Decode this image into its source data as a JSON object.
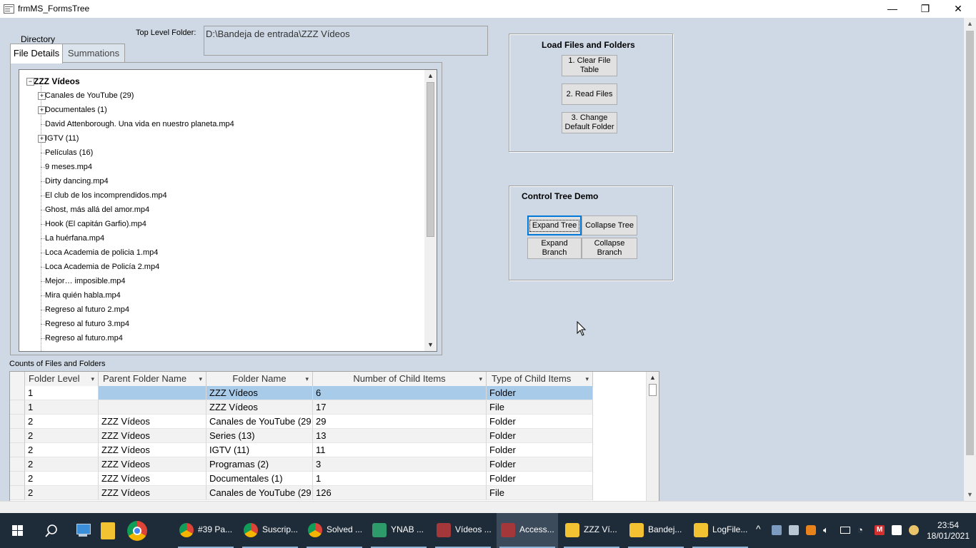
{
  "window": {
    "title": "frmMS_FormsTree",
    "controls": {
      "minimize": "—",
      "restore": "❐",
      "close": "✕"
    }
  },
  "form": {
    "directory_label": "Directory",
    "top_folder_label": "Top Level Folder:",
    "top_folder_value": "D:\\Bandeja de entrada\\ZZZ Vídeos",
    "tabs": [
      {
        "label": "File Details",
        "active": true
      },
      {
        "label": "Summations",
        "active": false
      }
    ],
    "tree": {
      "root": "ZZZ Vídeos",
      "nodes": [
        {
          "label": "Canales de YouTube (29)",
          "expandable": true
        },
        {
          "label": "Documentales (1)",
          "expandable": true
        },
        {
          "label": "David Attenborough. Una vida en nuestro planeta.mp4",
          "expandable": false
        },
        {
          "label": "IGTV (11)",
          "expandable": true
        },
        {
          "label": "Películas (16)",
          "expandable": false
        },
        {
          "label": "9 meses.mp4",
          "expandable": false
        },
        {
          "label": "Dirty dancing.mp4",
          "expandable": false
        },
        {
          "label": "El club de los incomprendidos.mp4",
          "expandable": false
        },
        {
          "label": "Ghost, más allá del amor.mp4",
          "expandable": false
        },
        {
          "label": "Hook (El capitán Garfio).mp4",
          "expandable": false
        },
        {
          "label": "La huérfana.mp4",
          "expandable": false
        },
        {
          "label": "Loca Academia de policia 1.mp4",
          "expandable": false
        },
        {
          "label": "Loca Academia de Policía 2.mp4",
          "expandable": false
        },
        {
          "label": "Mejor… imposible.mp4",
          "expandable": false
        },
        {
          "label": "Mira quién habla.mp4",
          "expandable": false
        },
        {
          "label": "Regreso al futuro 2.mp4",
          "expandable": false
        },
        {
          "label": "Regreso al futuro 3.mp4",
          "expandable": false
        },
        {
          "label": "Regreso al futuro.mp4",
          "expandable": false
        }
      ]
    },
    "load_group": {
      "title": "Load Files and Folders",
      "clear_button": "1. Clear File Table",
      "read_button": "2. Read Files",
      "change_button": "3. Change Default Folder"
    },
    "tree_group": {
      "title": "Control Tree Demo",
      "expand_tree": "Expand Tree",
      "collapse_tree": "Collapse Tree",
      "expand_branch": "Expand Branch",
      "collapse_branch": "Collapse Branch"
    },
    "counts_label": "Counts of Files and Folders",
    "table": {
      "columns": [
        "Folder Level",
        "Parent Folder Name",
        "Folder Name",
        "Number of Child Items",
        "Type of Child Items"
      ],
      "rows": [
        [
          "1",
          "",
          "ZZZ Vídeos",
          "6",
          "Folder"
        ],
        [
          "1",
          "",
          "ZZZ Vídeos",
          "17",
          "File"
        ],
        [
          "2",
          "ZZZ Vídeos",
          "Canales de YouTube (29",
          "29",
          "Folder"
        ],
        [
          "2",
          "ZZZ Vídeos",
          "Series (13)",
          "13",
          "Folder"
        ],
        [
          "2",
          "ZZZ Vídeos",
          "IGTV (11)",
          "11",
          "Folder"
        ],
        [
          "2",
          "ZZZ Vídeos",
          "Programas (2)",
          "3",
          "Folder"
        ],
        [
          "2",
          "ZZZ Vídeos",
          "Documentales (1)",
          "1",
          "Folder"
        ],
        [
          "2",
          "ZZZ Vídeos",
          "Canales de YouTube (29",
          "126",
          "File"
        ]
      ],
      "selected_row": 0
    }
  },
  "taskbar": {
    "apps": [
      {
        "label": "#39 Pa...",
        "icon": "chrome-icon"
      },
      {
        "label": "Suscrip...",
        "icon": "chrome-icon"
      },
      {
        "label": "Solved ...",
        "icon": "chrome-icon"
      },
      {
        "label": "YNAB ...",
        "icon": "ynab-icon"
      },
      {
        "label": "Vídeos ...",
        "icon": "access-icon"
      },
      {
        "label": "Access...",
        "icon": "access-icon"
      },
      {
        "label": "ZZZ Ví...",
        "icon": "folder-icon"
      },
      {
        "label": "Bandej...",
        "icon": "folder-icon"
      },
      {
        "label": "LogFile...",
        "icon": "folder-icon"
      }
    ],
    "time": "23:54",
    "date": "18/01/2021"
  },
  "colors": {
    "form_bg": "#cfd9e5",
    "selected_row": "#a9cbea",
    "taskbar": "#1e2c3a"
  }
}
